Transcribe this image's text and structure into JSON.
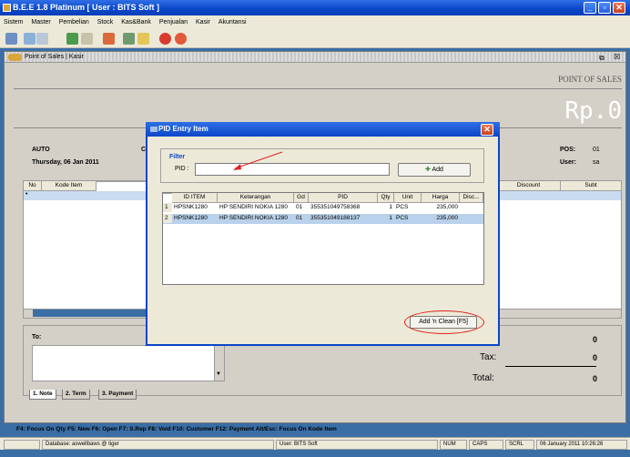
{
  "window": {
    "title": "B.E.E 1.8 Platinum [ User : BITS Soft ]"
  },
  "menu": [
    "Sistem",
    "Master",
    "Pembelian",
    "Stock",
    "Kas&Bank",
    "Penjualan",
    "Kasir",
    "Akuntansi"
  ],
  "pos_window": {
    "title": "Point of Sales | Kasir",
    "header": "POINT OF SALES",
    "amount": "Rp.0"
  },
  "info": {
    "mode": "AUTO",
    "date": "Thursday, 06 Jan 2011",
    "col_c": "C",
    "pos_label": "POS:",
    "pos_value": "01",
    "user_label": "User:",
    "user_value": "sa"
  },
  "main_grid": {
    "headers": [
      "No",
      "Kode Item",
      "Discount",
      "Subt"
    ]
  },
  "bottom": {
    "to_label": "To:",
    "tax_label": "Tax:",
    "tax_value": "0",
    "total_label": "Total:",
    "total_value": "0",
    "first_value": "0",
    "tabs": [
      "1. Note",
      "2. Term",
      "3. Payment"
    ]
  },
  "fkeys": "F4: Focus On Qty   F5: New   F6: Open   F7: S.Rep   F8: Void   F10: Customer   F12: Payment   Alt/Esc: Focus On Kode Item",
  "dialog": {
    "title": "PID Entry Item",
    "filter_label": "Filter",
    "pid_label": "PID :",
    "pid_value": "",
    "add_label": "Add",
    "add_clean_label": "Add 'n Clean [F5]",
    "headers": [
      "ID ITEM",
      "Keterangan",
      "Gd",
      "PID",
      "Qty",
      "Unit",
      "Harga",
      "Disc..."
    ],
    "rows": [
      {
        "n": "1",
        "id": "HPSNK1280",
        "ket": "HP SENDIRI NOKIA 1280",
        "gd": "01",
        "pid": "355351049758368",
        "qty": "1",
        "unit": "PCS",
        "harga": "235,000",
        "disc": ""
      },
      {
        "n": "2",
        "id": "HPSNK1280",
        "ket": "HP SENDIRI NOKIA 1280",
        "gd": "01",
        "pid": "355351049188137",
        "qty": "1",
        "unit": "PCS",
        "harga": "235,000",
        "disc": ""
      }
    ]
  },
  "status": {
    "database": "Database: aswellbaws @ tiger",
    "user": "User: BITS Soft",
    "num": "NUM",
    "caps": "CAPS",
    "scrl": "SCRL",
    "datetime": "06 January 2011  10:26:26"
  }
}
